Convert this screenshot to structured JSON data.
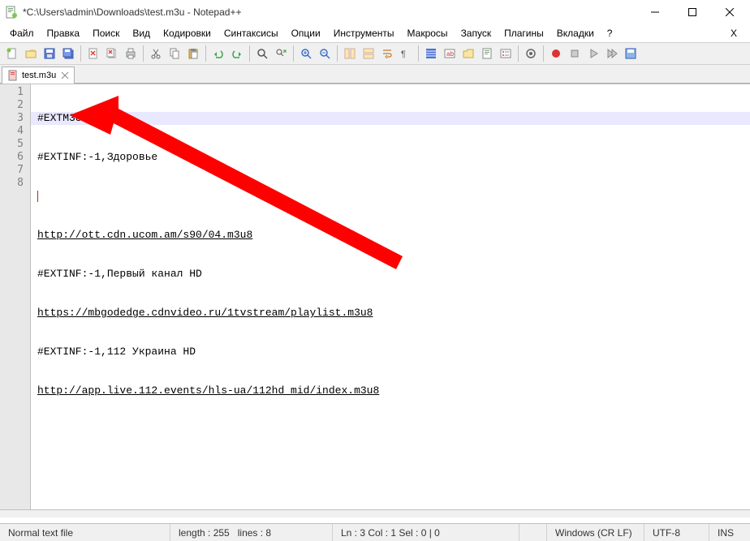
{
  "window": {
    "title": "*C:\\Users\\admin\\Downloads\\test.m3u - Notepad++"
  },
  "menu": {
    "items": [
      "Файл",
      "Правка",
      "Поиск",
      "Вид",
      "Кодировки",
      "Синтаксисы",
      "Опции",
      "Инструменты",
      "Макросы",
      "Запуск",
      "Плагины",
      "Вкладки",
      "?"
    ],
    "close_x": "X"
  },
  "tab": {
    "label": "test.m3u"
  },
  "code": {
    "line_numbers": [
      "1",
      "2",
      "3",
      "4",
      "5",
      "6",
      "7",
      "8"
    ],
    "lines": [
      {
        "text": "#EXTM3U",
        "link": false
      },
      {
        "text": "#EXTINF:-1,Здоровье",
        "link": false
      },
      {
        "text": "",
        "link": false
      },
      {
        "text": "http://ott.cdn.ucom.am/s90/04.m3u8",
        "link": true
      },
      {
        "text": "#EXTINF:-1,Первый канал HD",
        "link": false
      },
      {
        "text": "https://mbgodedge.cdnvideo.ru/1tvstream/playlist.m3u8",
        "link": true
      },
      {
        "text": "#EXTINF:-1,112 Украина HD",
        "link": false
      },
      {
        "text": "http://app.live.112.events/hls-ua/112hd_mid/index.m3u8",
        "link": true
      }
    ],
    "current_line_index": 2
  },
  "status": {
    "filetype": "Normal text file",
    "length_label": "length : 255",
    "lines_label": "lines : 8",
    "pos": "Ln : 3    Col : 1    Sel : 0 | 0",
    "eol": "Windows (CR LF)",
    "encoding": "UTF-8",
    "mode": "INS"
  }
}
